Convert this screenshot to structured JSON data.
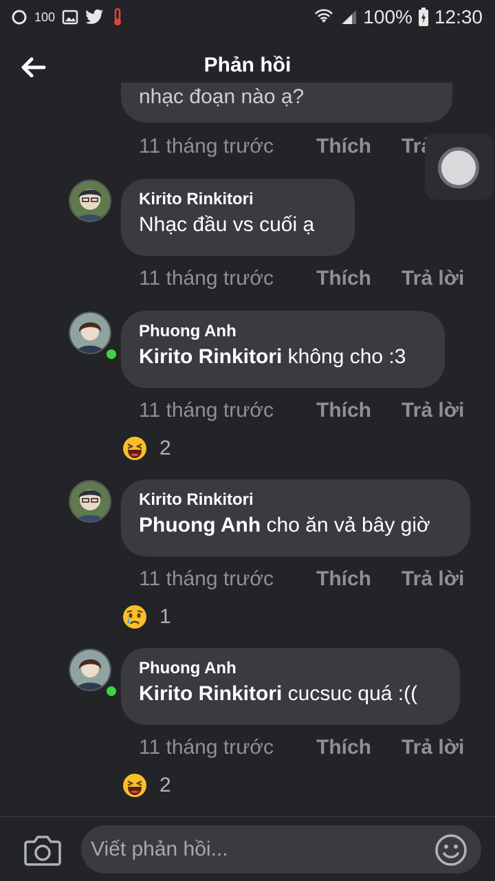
{
  "status_bar": {
    "notif_count": "100",
    "battery": "100%",
    "time": "12:30"
  },
  "header": {
    "title": "Phản hồi"
  },
  "top_partial": {
    "text": "nhạc đoạn nào ạ?",
    "time": "11 tháng trước",
    "like": "Thích",
    "reply": "Trả lời"
  },
  "comments": [
    {
      "author": "Kirito Rinkitori",
      "mention": "",
      "text": "Nhạc đầu vs cuối ạ",
      "time": "11 tháng trước",
      "like": "Thích",
      "reply": "Trả lời",
      "reaction_count": ""
    },
    {
      "author": "Phuong Anh",
      "mention": "Kirito Rinkitori",
      "text": " không cho :3",
      "time": "11 tháng trước",
      "like": "Thích",
      "reply": "Trả lời",
      "reaction_count": "2"
    },
    {
      "author": "Kirito Rinkitori",
      "mention": "Phuong Anh",
      "text": " cho ăn vả bây giờ",
      "time": "11 tháng trước",
      "like": "Thích",
      "reply": "Trả lời",
      "reaction_count": "1"
    },
    {
      "author": "Phuong Anh",
      "mention": "Kirito Rinkitori",
      "text": " cucsuc quá :((",
      "time": "11 tháng trước",
      "like": "Thích",
      "reply": "Trả lời",
      "reaction_count": "2"
    }
  ],
  "composer": {
    "placeholder": "Viết phản hồi..."
  },
  "colors": {
    "background": "#232427",
    "bubble": "#3a3b3f",
    "online": "#42d13e",
    "muted": "#8e9096"
  }
}
